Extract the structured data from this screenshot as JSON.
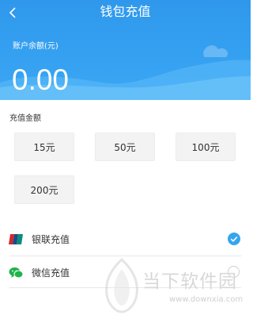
{
  "header": {
    "title": "钱包充值",
    "back_icon": "chevron-left-icon",
    "balance_label": "账户余额(元)",
    "balance_value": "0.00",
    "colors": {
      "top": "#2f98ec",
      "bottom": "#3aa7f4"
    }
  },
  "recharge": {
    "section_label": "充值金额",
    "amounts": [
      "15元",
      "50元",
      "100元",
      "200元"
    ]
  },
  "payment": {
    "methods": [
      {
        "label": "银联充值",
        "icon": "unionpay-icon",
        "selected": true
      },
      {
        "label": "微信充值",
        "icon": "wechat-icon",
        "selected": false
      }
    ]
  },
  "watermark": {
    "text": "当下软件园",
    "url": "www.downxia.com"
  }
}
